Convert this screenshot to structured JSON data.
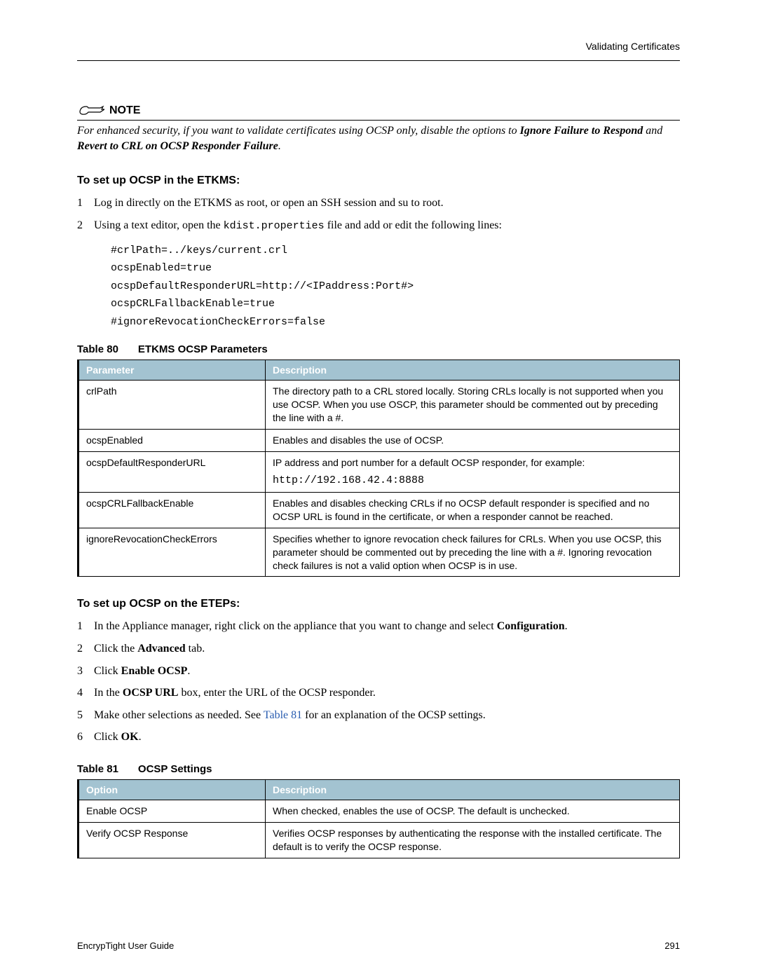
{
  "header": {
    "right_text": "Validating Certificates"
  },
  "note": {
    "label": "NOTE",
    "text_parts": {
      "p1": "For enhanced security, if you want to validate certificates using OCSP only, disable the options to ",
      "b1": "Ignore Failure to Respond",
      "p2": " and ",
      "b2": "Revert to CRL on OCSP Responder Failure",
      "p3": "."
    }
  },
  "section1": {
    "heading": "To set up OCSP in the ETKMS:",
    "items": [
      {
        "num": "1",
        "text": "Log in directly on the ETKMS as root, or open an SSH session and su to root."
      },
      {
        "num": "2",
        "pre": "Using a text editor, open the ",
        "code": "kdist.properties",
        "post": " file and add or edit the following lines:"
      }
    ],
    "code_lines": [
      "#crlPath=../keys/current.crl",
      "ocspEnabled=true",
      "ocspDefaultResponderURL=http://<IPaddress:Port#>",
      "ocspCRLFallbackEnable=true",
      "#ignoreRevocationCheckErrors=false"
    ]
  },
  "table80": {
    "caption_label": "Table 80",
    "caption_title": "ETKMS OCSP Parameters",
    "headers": [
      "Parameter",
      "Description"
    ],
    "rows": [
      {
        "param": "crlPath",
        "desc": "The directory path to a CRL stored locally. Storing CRLs locally is not supported when you use OCSP. When you use OSCP, this parameter should be commented out by preceding the line with a #."
      },
      {
        "param": "ocspEnabled",
        "desc": "Enables and disables the use of OCSP."
      },
      {
        "param": "ocspDefaultResponderURL",
        "desc_pre": "IP address and port number for a default OCSP responder, for example:",
        "desc_code": "http://192.168.42.4:8888"
      },
      {
        "param": "ocspCRLFallbackEnable",
        "desc": "Enables and disables checking CRLs if no OCSP default responder is specified and no OCSP URL is found in the certificate, or when a responder cannot be reached."
      },
      {
        "param": "ignoreRevocationCheckErrors",
        "desc": "Specifies whether to ignore revocation check failures for CRLs. When you use OCSP, this parameter should be commented out by preceding the line with a #. Ignoring revocation check failures is not a valid option when OCSP is in use."
      }
    ]
  },
  "section2": {
    "heading": "To set up OCSP on the ETEPs:",
    "items": [
      {
        "num": "1",
        "parts": [
          "In the Appliance manager, right click on the appliance that you want to change and select ",
          "Configuration",
          "."
        ]
      },
      {
        "num": "2",
        "parts": [
          "Click the ",
          "Advanced",
          " tab."
        ]
      },
      {
        "num": "3",
        "parts": [
          "Click ",
          "Enable OCSP",
          "."
        ]
      },
      {
        "num": "4",
        "parts": [
          "In the ",
          "OCSP URL",
          " box, enter the URL of the OCSP responder."
        ]
      },
      {
        "num": "5",
        "parts": [
          "Make other selections as needed. See ",
          "Table 81",
          " for an explanation of the OCSP settings."
        ],
        "link_index": 1
      },
      {
        "num": "6",
        "parts": [
          "Click ",
          "OK",
          "."
        ]
      }
    ]
  },
  "table81": {
    "caption_label": "Table 81",
    "caption_title": "OCSP Settings",
    "headers": [
      "Option",
      "Description"
    ],
    "rows": [
      {
        "param": "Enable OCSP",
        "desc": "When checked, enables the use of OCSP. The default is unchecked."
      },
      {
        "param": "Verify OCSP Response",
        "desc": "Verifies OCSP responses by authenticating the response with the installed certificate. The default is to verify the OCSP response."
      }
    ]
  },
  "footer": {
    "left": "EncrypTight User Guide",
    "right": "291"
  }
}
